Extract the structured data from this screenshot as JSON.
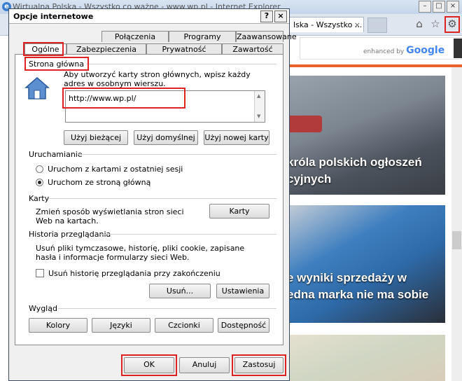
{
  "browser": {
    "title": "Wirtualna Polska - Wszystko co ważne - www.wp.pl - Internet Explorer",
    "tab_label": "lska - Wszystko ...",
    "tab_close": "×",
    "search": {
      "enhanced_by": "enhanced by",
      "google": "Google"
    },
    "icons": [
      "home-icon",
      "star-icon",
      "gear-icon"
    ],
    "window_buttons": [
      "–",
      "□",
      "×"
    ],
    "news": [
      {
        "headline_line1": "króla polskich ogłoszeń",
        "headline_line2": "cyjnych"
      },
      {
        "headline_line1": "e wyniki sprzedaży w",
        "headline_line2": "edna marka nie ma sobie"
      }
    ],
    "accent_color": "#e8632c"
  },
  "dialog": {
    "title": "Opcje internetowe",
    "title_buttons": {
      "help": "?",
      "close": "×"
    },
    "tabs_back": [
      "Połączenia",
      "Programy",
      "Zaawansowane"
    ],
    "tabs_front": [
      "Ogólne",
      "Zabezpieczenia",
      "Prywatność",
      "Zawartość"
    ],
    "active_tab": "Ogólne",
    "home": {
      "section_label": "Strona główna",
      "description": "Aby utworzyć karty stron głównych, wpisz każdy adres w osobnym wierszu.",
      "url_value": "http://www.wp.pl/",
      "buttons": [
        "Użyj bieżącej",
        "Użyj domyślnej",
        "Użyj nowej karty"
      ]
    },
    "startup": {
      "section_label": "Uruchamianie",
      "options": [
        "Uruchom z kartami z ostatniej sesji",
        "Uruchom ze stroną główną"
      ],
      "selected_index": 1
    },
    "tabs_section": {
      "section_label": "Karty",
      "description": "Zmień sposób wyświetlania stron sieci Web na kartach.",
      "button": "Karty"
    },
    "history": {
      "section_label": "Historia przeglądania",
      "description": "Usuń pliki tymczasowe, historię, pliki cookie, zapisane hasła i informacje formularzy sieci Web.",
      "checkbox_label": "Usuń historię przeglądania przy zakończeniu",
      "checkbox_checked": false,
      "delete_button": "Usuń...",
      "settings_button": "Ustawienia"
    },
    "appearance": {
      "section_label": "Wygląd",
      "buttons": [
        "Kolory",
        "Języki",
        "Czcionki",
        "Dostępność"
      ]
    },
    "footer": {
      "ok": "OK",
      "cancel": "Anuluj",
      "apply": "Zastosuj"
    },
    "highlight_color": "#d22222"
  }
}
